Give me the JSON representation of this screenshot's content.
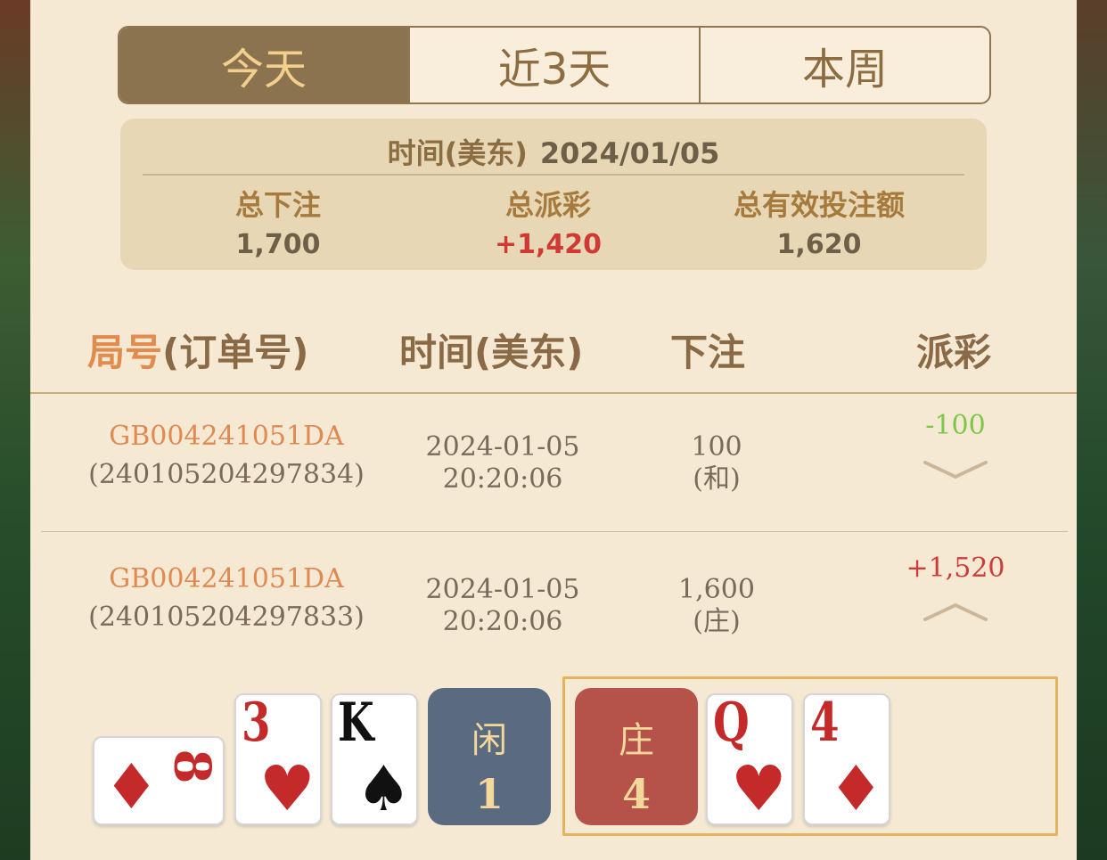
{
  "tabs": [
    {
      "label": "今天",
      "active": true
    },
    {
      "label": "近3天",
      "active": false
    },
    {
      "label": "本周",
      "active": false
    }
  ],
  "summary": {
    "time_label": "时间(美东)",
    "date": "2024/01/05",
    "total_bet_label": "总下注",
    "total_bet_value": "1,700",
    "total_payout_label": "总派彩",
    "total_payout_value": "+1,420",
    "total_valid_label": "总有效投注额",
    "total_valid_value": "1,620"
  },
  "table": {
    "headers": {
      "round_accent": "局号",
      "round_rest": "(订单号)",
      "time": "时间(美东)",
      "bet": "下注",
      "payout": "派彩"
    },
    "rows": [
      {
        "round_id": "GB004241051DA",
        "order_no": "(240105204297834)",
        "date": "2024-01-05",
        "time": "20:20:06",
        "bet_amount": "100",
        "bet_type": "(和)",
        "payout": "-100",
        "payout_color": "#7cc648",
        "expanded": false
      },
      {
        "round_id": "GB004241051DA",
        "order_no": "(240105204297833)",
        "date": "2024-01-05",
        "time": "20:20:06",
        "bet_amount": "1,600",
        "bet_type": "(庄)",
        "payout": "+1,520",
        "payout_color": "#cf3b3a",
        "expanded": true
      }
    ]
  },
  "result": {
    "player_cards": [
      {
        "rank": "8",
        "suit": "diamond",
        "rotated": true
      },
      {
        "rank": "3",
        "suit": "heart"
      },
      {
        "rank": "K",
        "suit": "spade"
      }
    ],
    "player_label": "闲",
    "player_score": "1",
    "player_color": "#5a6a80",
    "banker_label": "庄",
    "banker_score": "4",
    "banker_color": "#b5524a",
    "banker_cards": [
      {
        "rank": "Q",
        "suit": "heart"
      },
      {
        "rank": "4",
        "suit": "diamond"
      }
    ],
    "winner": "banker"
  }
}
